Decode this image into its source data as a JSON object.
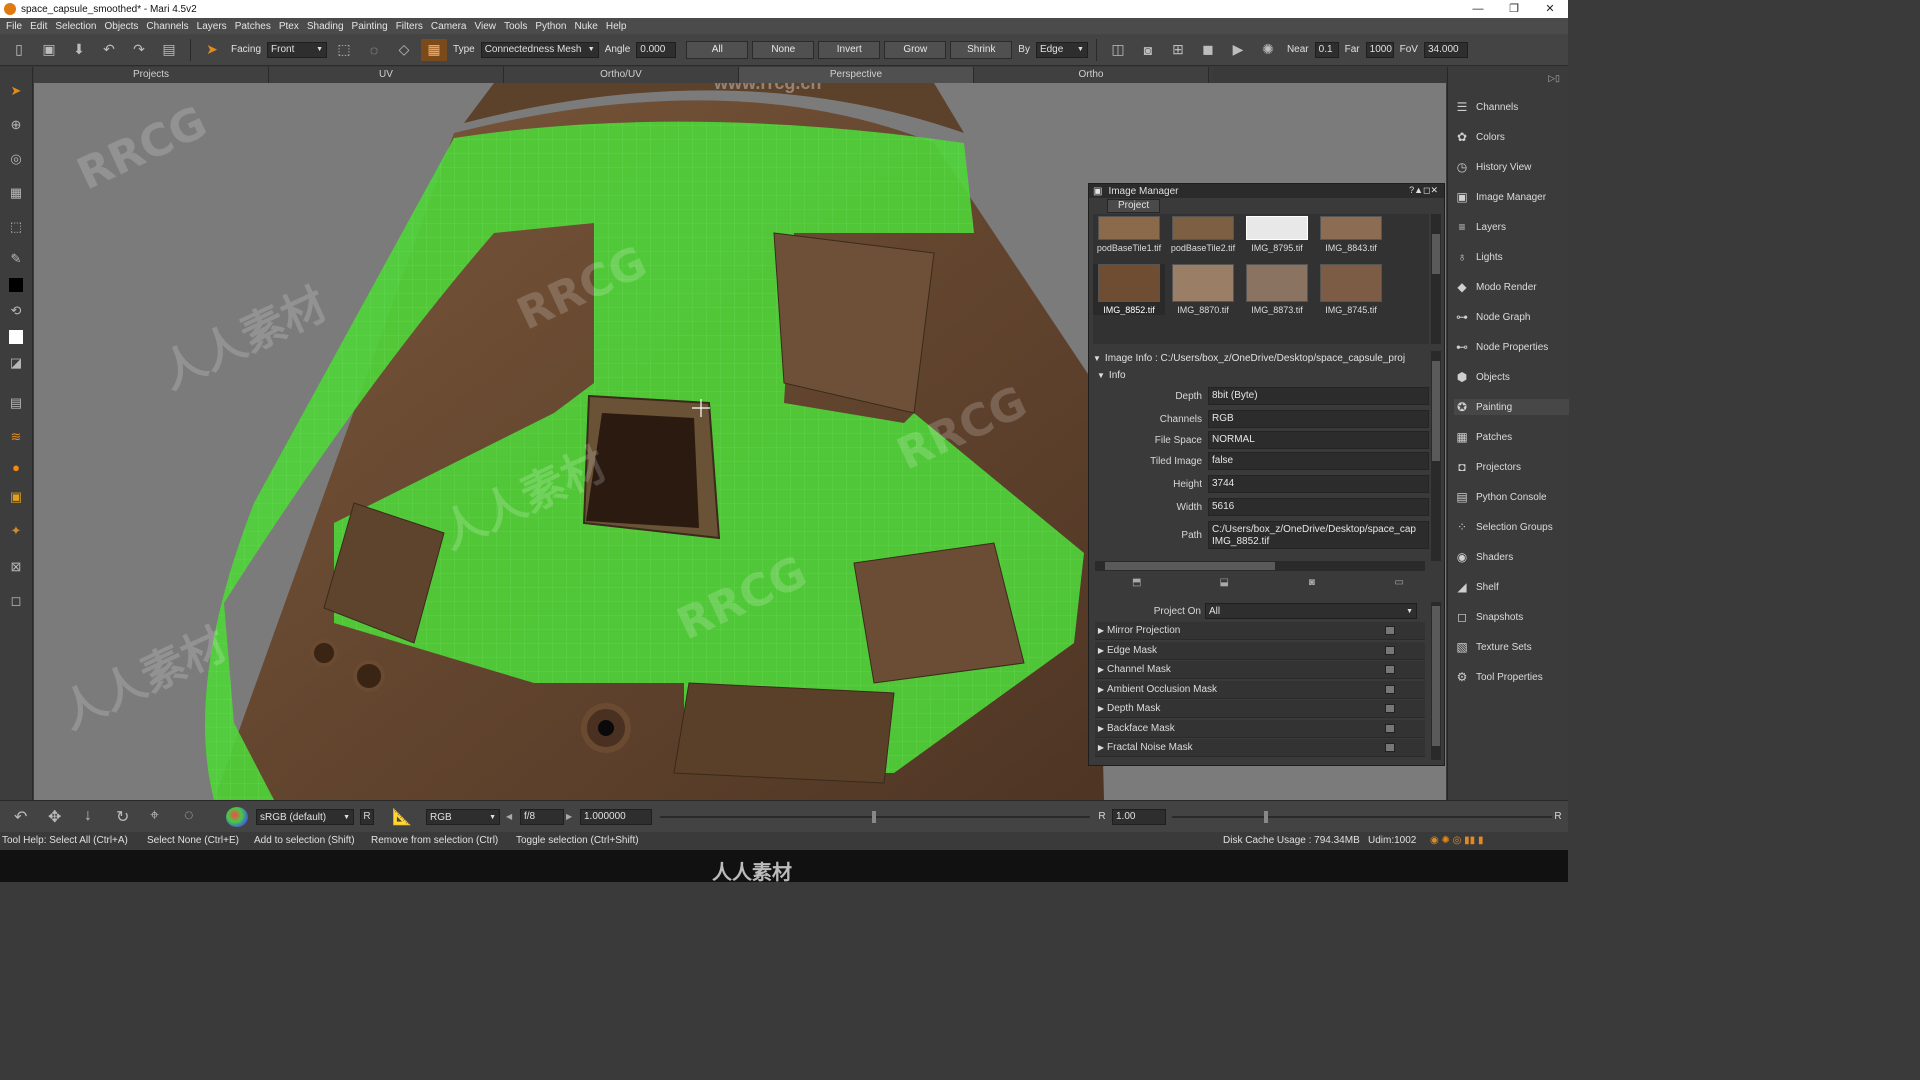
{
  "window": {
    "title": "space_capsule_smoothed* - Mari 4.5v2",
    "watermark_site": "www.rrcg.cn",
    "watermark_brand": "RRCG",
    "watermark_cn": "人人素材",
    "minimize": "—",
    "restore": "❐",
    "close": "✕"
  },
  "menu": [
    "File",
    "Edit",
    "Selection",
    "Objects",
    "Channels",
    "Layers",
    "Patches",
    "Ptex",
    "Shading",
    "Painting",
    "Filters",
    "Camera",
    "View",
    "Tools",
    "Python",
    "Nuke",
    "Help"
  ],
  "toolbar": {
    "facing_label": "Facing",
    "facing_value": "Front",
    "type_label": "Type",
    "type_value": "Connectedness Mesh",
    "angle_label": "Angle",
    "angle_value": "0.000",
    "btn_all": "All",
    "btn_none": "None",
    "btn_invert": "Invert",
    "btn_grow": "Grow",
    "btn_shrink": "Shrink",
    "by_label": "By",
    "by_value": "Edge",
    "near_label": "Near",
    "near_value": "0.1",
    "far_label": "Far",
    "far_value": "1000",
    "fov_label": "FoV",
    "fov_value": "34.000"
  },
  "view_tabs": [
    "Projects",
    "UV",
    "Ortho/UV",
    "Perspective",
    "Ortho"
  ],
  "right_panel": {
    "items": [
      "Channels",
      "Colors",
      "History View",
      "Image Manager",
      "Layers",
      "Lights",
      "Modo Render",
      "Node Graph",
      "Node Properties",
      "Objects",
      "Painting",
      "Patches",
      "Projectors",
      "Python Console",
      "Selection Groups",
      "Shaders",
      "Shelf",
      "Snapshots",
      "Texture Sets",
      "Tool Properties"
    ]
  },
  "image_manager": {
    "title": "Image Manager",
    "project_tab": "Project",
    "thumbnails": [
      {
        "name": "podBaseTile1.tif",
        "color": "#8a6a4a"
      },
      {
        "name": "podBaseTile2.tif",
        "color": "#7d5f44"
      },
      {
        "name": "IMG_8795.tif",
        "color": "#e8e8e8"
      },
      {
        "name": "IMG_8843.tif",
        "color": "#8c6c52"
      },
      {
        "name": "IMG_8852.tif",
        "color": "#6e4d33"
      },
      {
        "name": "IMG_8870.tif",
        "color": "#9a7e66"
      },
      {
        "name": "IMG_8873.tif",
        "color": "#8a7461"
      },
      {
        "name": "IMG_8745.tif",
        "color": "#7c5c44"
      }
    ],
    "info_header": "Image Info : C:/Users/box_z/OneDrive/Desktop/space_capsule_proj",
    "info_group": "Info",
    "info": [
      {
        "label": "Depth",
        "value": "8bit (Byte)"
      },
      {
        "label": "Channels",
        "value": "RGB"
      },
      {
        "label": "File Space",
        "value": "NORMAL"
      },
      {
        "label": "Tiled Image",
        "value": "false"
      },
      {
        "label": "Height",
        "value": "3744"
      },
      {
        "label": "Width",
        "value": "5616"
      },
      {
        "label": "Path",
        "value": "C:/Users/box_z/OneDrive/Desktop/space_cap IMG_8852.tif"
      }
    ],
    "project_on_label": "Project On",
    "project_on_value": "All",
    "masks": [
      "Mirror Projection",
      "Edge Mask",
      "Channel Mask",
      "Ambient Occlusion Mask",
      "Depth Mask",
      "Backface Mask",
      "Fractal Noise Mask"
    ]
  },
  "bottom": {
    "colorspace": "sRGB (default)",
    "r_label": "R",
    "channel": "RGB",
    "fstop": "f/8",
    "exposure": "1.000000",
    "gamma_label": "R",
    "gamma_value": "1.00"
  },
  "status": {
    "help": "Tool Help: Select All (Ctrl+A)",
    "h2": "Select None (Ctrl+E)",
    "h3": "Add to selection (Shift)",
    "h4": "Remove from selection (Ctrl)",
    "h5": "Toggle selection (Ctrl+Shift)",
    "disk": "Disk Cache Usage : 794.34MB",
    "udim": "Udim:1002"
  },
  "colors": {
    "selection_green": "#4fd23a",
    "capsule_brown": "#6b4a30",
    "viewport_bg": "#7b7b7b"
  }
}
